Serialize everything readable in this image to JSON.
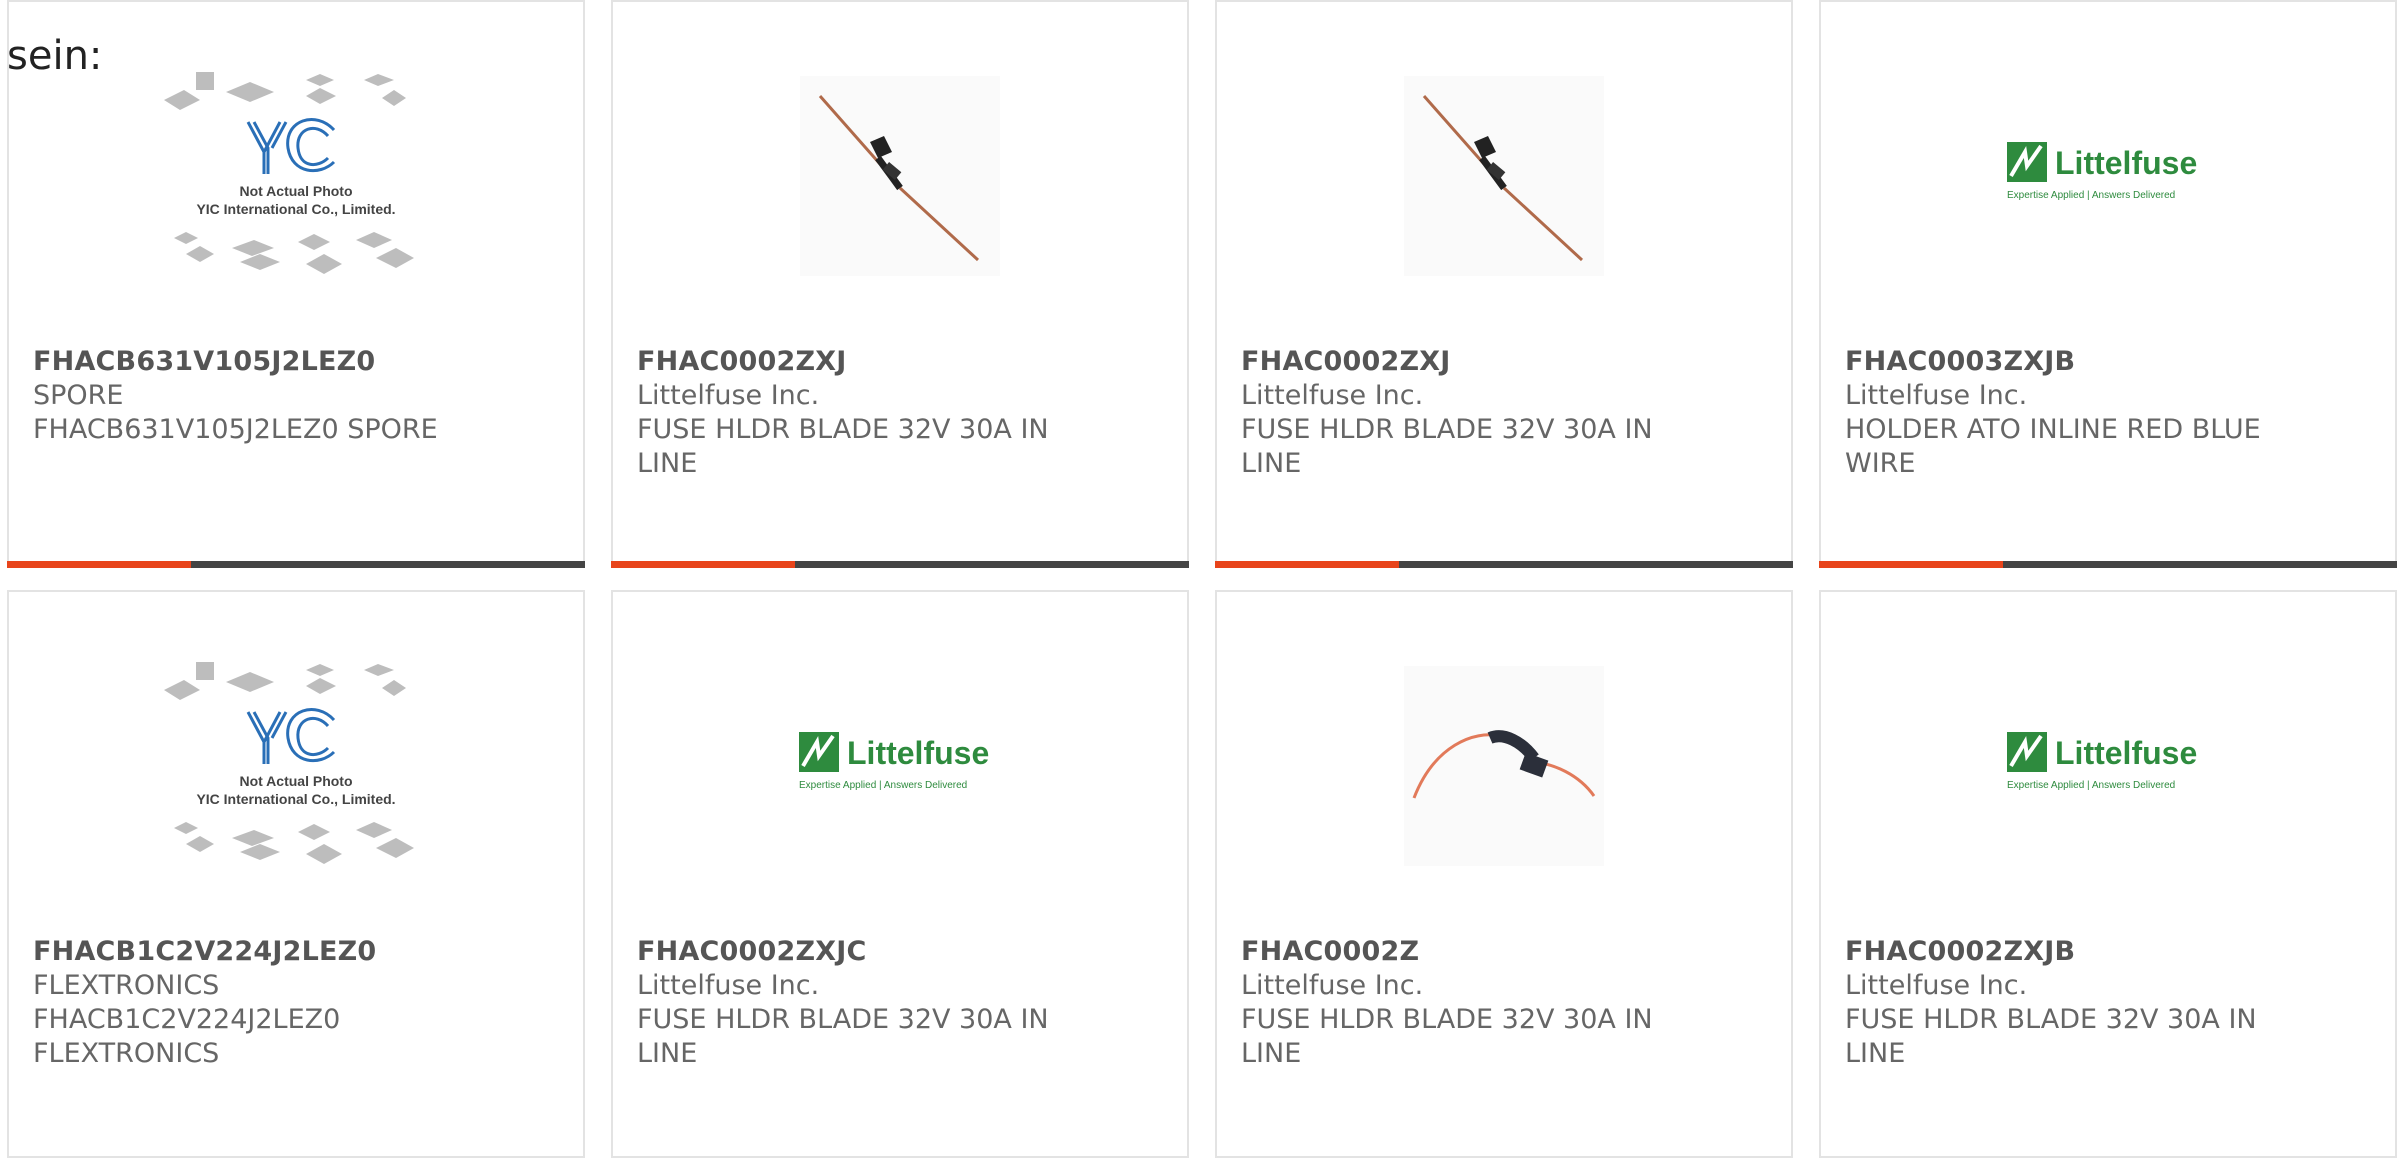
{
  "lead_text": "sein:",
  "colors": {
    "accent": "#e8441b",
    "bar": "#444444",
    "border": "#e3e3e3",
    "logo_green": "#2e8b3e"
  },
  "placeholder": {
    "line1": "Not Actual Photo",
    "line2": "YIC International Co., Limited."
  },
  "logo": {
    "brand": "Littelfuse",
    "tagline": "Expertise Applied | Answers Delivered"
  },
  "products": [
    {
      "part": "FHACB631V105J2LEZ0",
      "manufacturer": "SPORE",
      "description": "FHACB631V105J2LEZ0 SPORE",
      "image": "yic-placeholder"
    },
    {
      "part": "FHAC0002ZXJ",
      "manufacturer": "Littelfuse Inc.",
      "description": "FUSE HLDR BLADE 32V 30A IN LINE",
      "image": "fuse-diagonal-photo"
    },
    {
      "part": "FHAC0002ZXJ",
      "manufacturer": "Littelfuse Inc.",
      "description": "FUSE HLDR BLADE 32V 30A IN LINE",
      "image": "fuse-diagonal-photo"
    },
    {
      "part": "FHAC0003ZXJB",
      "manufacturer": "Littelfuse Inc.",
      "description": "HOLDER ATO INLINE RED BLUE WIRE",
      "image": "littelfuse-logo"
    },
    {
      "part": "FHACB1C2V224J2LEZ0",
      "manufacturer": "FLEXTRONICS",
      "description": "FHACB1C2V224J2LEZ0 FLEXTRONICS",
      "image": "yic-placeholder"
    },
    {
      "part": "FHAC0002ZXJC",
      "manufacturer": "Littelfuse Inc.",
      "description": "FUSE HLDR BLADE 32V 30A IN LINE",
      "image": "littelfuse-logo"
    },
    {
      "part": "FHAC0002Z",
      "manufacturer": "Littelfuse Inc.",
      "description": "FUSE HLDR BLADE 32V 30A IN LINE",
      "image": "fuse-curved-photo"
    },
    {
      "part": "FHAC0002ZXJB",
      "manufacturer": "Littelfuse Inc.",
      "description": "FUSE HLDR BLADE 32V 30A IN LINE",
      "image": "littelfuse-logo"
    }
  ]
}
